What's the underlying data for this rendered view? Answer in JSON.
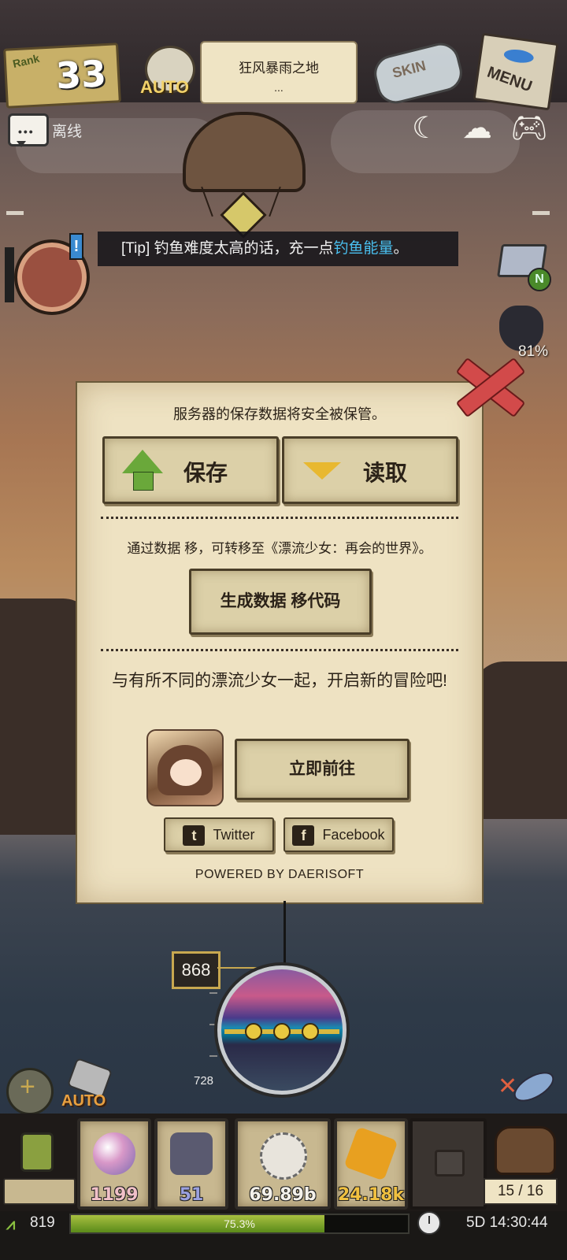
{
  "hud": {
    "rank_label": "Rank",
    "rank_value": "33",
    "auto_label": "AUTO",
    "location": "狂风暴雨之地",
    "location_sub": "...",
    "skin_label": "SKIN",
    "menu_label": "MENU",
    "offline_label": "离线"
  },
  "tip": {
    "prefix": "[Tip] 钓鱼难度太高的话，充一点",
    "highlight": "钓鱼能量",
    "suffix": "。"
  },
  "side": {
    "cart_badge": "N",
    "pet_percent": "81%"
  },
  "dialog": {
    "server_notice": "服务器的保存数据将安全被保管。",
    "save_label": "保存",
    "load_label": "读取",
    "transfer_notice": "通过数据 移，可转移至《漂流少女：再会的世界》。",
    "code_button": "生成数据 移代码",
    "promo_text": "与有所不同的漂流少女一起，开启新的冒险吧!",
    "go_button": "立即前往",
    "twitter_label": "Twitter",
    "facebook_label": "Facebook",
    "powered_by": "POWERED BY DAERISOFT"
  },
  "gauge": {
    "depth": "868",
    "min_depth": "728"
  },
  "bottom_tools": {
    "auto_label": "AUTO"
  },
  "inventory": [
    {
      "name": "orb",
      "count": "1199",
      "color": "#f0c0c8"
    },
    {
      "name": "spider-web",
      "count": "51",
      "color": "#9aa0e0"
    },
    {
      "name": "shell",
      "count": "69.89b",
      "color": "#f4f1ea"
    },
    {
      "name": "gold-ore",
      "count": "24.18k",
      "color": "#f0c040"
    }
  ],
  "bag_count": "15 / 16",
  "status": {
    "level": "819",
    "xp_percent_text": "75.3%",
    "xp_fraction": 0.753,
    "time": "5D 14:30:44"
  },
  "colors": {
    "tip_highlight": "#4ac0f0",
    "xp_fill": "#8ab030",
    "close_red": "#d24a4a"
  }
}
